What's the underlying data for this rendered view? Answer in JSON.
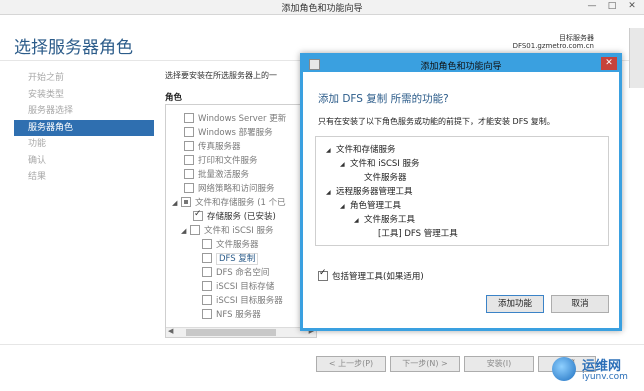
{
  "window": {
    "title": "添加角色和功能向导",
    "min": "—",
    "max": "□",
    "close": "✕"
  },
  "header": {
    "title": "选择服务器角色",
    "dest_label": "目标服务器",
    "dest_server": "DFS01.gzmetro.com.cn"
  },
  "nav": {
    "items": [
      {
        "label": "开始之前"
      },
      {
        "label": "安装类型"
      },
      {
        "label": "服务器选择"
      },
      {
        "label": "服务器角色"
      },
      {
        "label": "功能"
      },
      {
        "label": "确认"
      },
      {
        "label": "结果"
      }
    ],
    "active_index": 3
  },
  "main": {
    "description": "选择要安装在所选服务器上的一",
    "column_header": "角色",
    "roles": [
      {
        "label": "Windows Server 更新"
      },
      {
        "label": "Windows 部署服务"
      },
      {
        "label": "传真服务器"
      },
      {
        "label": "打印和文件服务"
      },
      {
        "label": "批量激活服务"
      },
      {
        "label": "网络策略和访问服务"
      },
      {
        "label": "文件和存储服务 (1 个已"
      },
      {
        "label": "存储服务 (已安装)"
      },
      {
        "label": "文件和 iSCSI 服务"
      },
      {
        "label": "文件服务器"
      },
      {
        "label": "DFS 复制"
      },
      {
        "label": "DFS 命名空间"
      },
      {
        "label": "iSCSI 目标存储"
      },
      {
        "label": "iSCSI 目标服务器"
      },
      {
        "label": "NFS 服务器"
      }
    ]
  },
  "footer": {
    "prev": "< 上一步(P)",
    "next": "下一步(N) >",
    "install": "安装(I)",
    "cancel": "取消"
  },
  "dialog": {
    "title": "添加角色和功能向导",
    "close": "✕",
    "heading": "添加 DFS 复制 所需的功能?",
    "description": "只有在安装了以下角色服务或功能的前提下，才能安装 DFS 复制。",
    "tree": [
      {
        "label": "文件和存储服务",
        "expander": "◢"
      },
      {
        "label": "文件和 iSCSI 服务",
        "expander": "◢"
      },
      {
        "label": "文件服务器",
        "expander": ""
      },
      {
        "label": "远程服务器管理工具",
        "expander": "◢"
      },
      {
        "label": "角色管理工具",
        "expander": "◢"
      },
      {
        "label": "文件服务工具",
        "expander": "◢"
      },
      {
        "label": "[工具] DFS 管理工具",
        "expander": ""
      }
    ],
    "include_label": "包括管理工具(如果适用)",
    "add_button": "添加功能",
    "cancel_button": "取消"
  },
  "watermark": {
    "line1": "运维网",
    "line2": "iyunv.com"
  }
}
